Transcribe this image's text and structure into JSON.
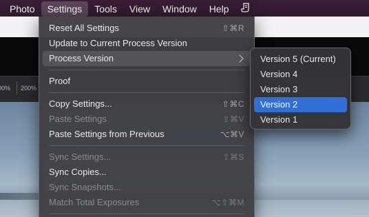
{
  "menubar": {
    "items": [
      {
        "label": "Photo"
      },
      {
        "label": "Settings"
      },
      {
        "label": "Tools"
      },
      {
        "label": "View"
      },
      {
        "label": "Window"
      },
      {
        "label": "Help"
      }
    ],
    "extra_icon": "script-icon"
  },
  "toolbar": {
    "zoom_a": "00%",
    "zoom_b": "200%"
  },
  "settings_menu": {
    "items": [
      {
        "label": "Reset All Settings",
        "shortcut": "⇧⌘R",
        "enabled": true
      },
      {
        "label": "Update to Current Process Version",
        "shortcut": "",
        "enabled": true
      },
      {
        "label": "Process Version",
        "shortcut": "",
        "enabled": true,
        "submenu": true
      },
      {
        "label": "Proof",
        "shortcut": "",
        "enabled": true
      },
      {
        "label": "Copy Settings...",
        "shortcut": "⇧⌘C",
        "enabled": true
      },
      {
        "label": "Paste Settings",
        "shortcut": "⇧⌘V",
        "enabled": false
      },
      {
        "label": "Paste Settings from Previous",
        "shortcut": "⌥⌘V",
        "enabled": true
      },
      {
        "label": "Sync Settings...",
        "shortcut": "⇧⌘S",
        "enabled": false
      },
      {
        "label": "Sync Copies...",
        "shortcut": "",
        "enabled": true
      },
      {
        "label": "Sync Snapshots...",
        "shortcut": "",
        "enabled": false
      },
      {
        "label": "Match Total Exposures",
        "shortcut": "⌥⇧⌘M",
        "enabled": false
      }
    ]
  },
  "process_version_submenu": {
    "items": [
      {
        "label": "Version 5 (Current)"
      },
      {
        "label": "Version 4"
      },
      {
        "label": "Version 3"
      },
      {
        "label": "Version 2",
        "highlighted": true
      },
      {
        "label": "Version 1"
      }
    ]
  },
  "colors": {
    "highlight": "#2f6fd6",
    "menubar": "#351c33"
  }
}
